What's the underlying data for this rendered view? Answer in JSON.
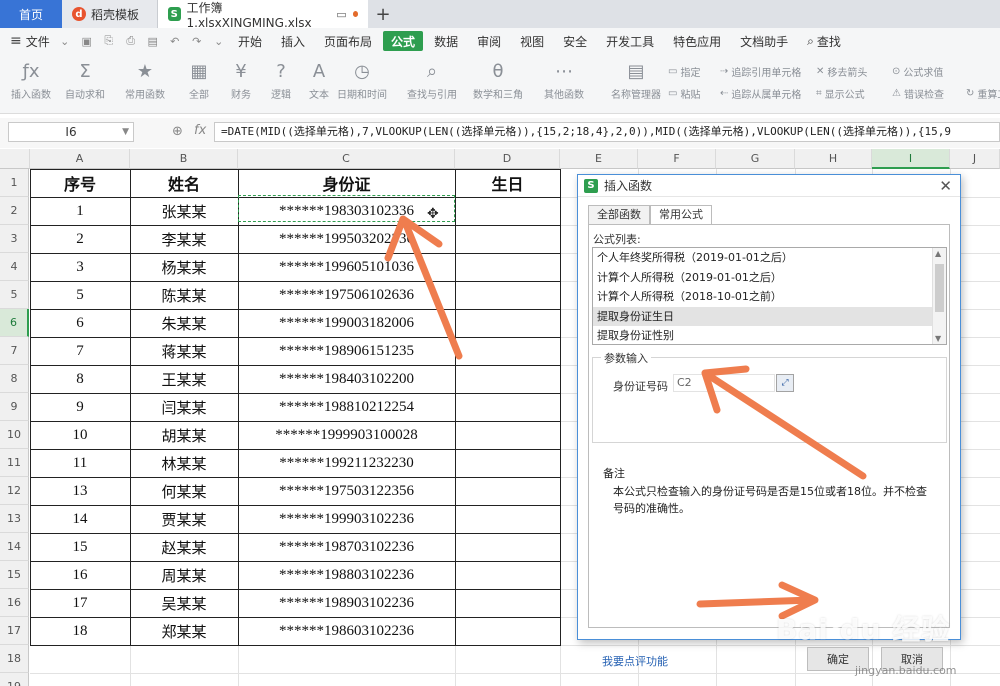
{
  "tabs": {
    "home": "首页",
    "template": "稻壳模板",
    "document": "工作簿1.xlsxXINGMING.xlsx",
    "add": "+"
  },
  "menu": {
    "file": "文件",
    "items": [
      "开始",
      "插入",
      "页面布局",
      "公式",
      "数据",
      "审阅",
      "视图",
      "安全",
      "开发工具",
      "特色应用",
      "文档助手"
    ],
    "active_index": 3,
    "search": "查找"
  },
  "ribbon": {
    "buttons": [
      "插入函数",
      "自动求和",
      "常用函数",
      "全部",
      "财务",
      "逻辑",
      "文本",
      "日期和时间",
      "查找与引用",
      "数学和三角",
      "其他函数",
      "名称管理器"
    ],
    "small": {
      "define": "指定",
      "paste": "粘贴",
      "trace_precedents": "追踪引用单元格",
      "trace_dependents": "追踪从属单元格",
      "remove_arrows": "移去箭头",
      "show_formulas": "显示公式",
      "evaluate": "公式求值",
      "error_check": "错误检查",
      "recalc": "重算工"
    }
  },
  "formula_bar": {
    "name_box": "I6",
    "formula": "=DATE(MID((选择单元格),7,VLOOKUP(LEN((选择单元格)),{15,2;18,4},2,0)),MID((选择单元格),VLOOKUP(LEN((选择单元格)),{15,9"
  },
  "sheet": {
    "columns": [
      "A",
      "B",
      "C",
      "D",
      "E",
      "F",
      "G",
      "H",
      "I",
      "J"
    ],
    "selected_column": "I",
    "selected_row": "6",
    "headers": [
      "序号",
      "姓名",
      "身份证",
      "生日"
    ],
    "rows": [
      {
        "row": "2",
        "no": "1",
        "name": "张某某",
        "id": "******198303102336"
      },
      {
        "row": "3",
        "no": "2",
        "name": "李某某",
        "id": "******199503202336"
      },
      {
        "row": "4",
        "no": "3",
        "name": "杨某某",
        "id": "******199605101036"
      },
      {
        "row": "5",
        "no": "5",
        "name": "陈某某",
        "id": "******197506102636"
      },
      {
        "row": "6",
        "no": "6",
        "name": "朱某某",
        "id": "******199003182006"
      },
      {
        "row": "7",
        "no": "7",
        "name": "蒋某某",
        "id": "******198906151235"
      },
      {
        "row": "8",
        "no": "8",
        "name": "王某某",
        "id": "******198403102200"
      },
      {
        "row": "9",
        "no": "9",
        "name": "闫某某",
        "id": "******198810212254"
      },
      {
        "row": "10",
        "no": "10",
        "name": "胡某某",
        "id": "******1999903100028"
      },
      {
        "row": "11",
        "no": "11",
        "name": "林某某",
        "id": "******199211232230"
      },
      {
        "row": "12",
        "no": "13",
        "name": "何某某",
        "id": "******197503122356"
      },
      {
        "row": "13",
        "no": "14",
        "name": "贾某某",
        "id": "******199903102236"
      },
      {
        "row": "14",
        "no": "15",
        "name": "赵某某",
        "id": "******198703102236"
      },
      {
        "row": "15",
        "no": "16",
        "name": "周某某",
        "id": "******198803102236"
      },
      {
        "row": "16",
        "no": "17",
        "name": "吴某某",
        "id": "******198903102236"
      },
      {
        "row": "17",
        "no": "18",
        "name": "郑某某",
        "id": "******198603102236"
      }
    ],
    "row_header_labels": [
      "1",
      "2",
      "3",
      "4",
      "5",
      "6",
      "7",
      "8",
      "9",
      "10",
      "11",
      "12",
      "13",
      "14",
      "15",
      "16",
      "17",
      "18",
      "19"
    ]
  },
  "dialog": {
    "title": "插入函数",
    "tabs": [
      "全部函数",
      "常用公式"
    ],
    "active_tab": 1,
    "list_label": "公式列表:",
    "list_items": [
      "个人年终奖所得税（2019-01-01之后）",
      "计算个人所得税（2019-01-01之后）",
      "计算个人所得税（2018-10-01之前）",
      "提取身份证生日",
      "提取身份证性别"
    ],
    "selected_index": 3,
    "params_label": "参数输入",
    "param_name": "身份证号码",
    "param_value": "C2",
    "note_title": "备注",
    "note_text": "本公式只检查输入的身份证号码是否是15位或者18位。并不检查号码的准确性。",
    "feedback_link": "我要点评功能",
    "ok": "确定",
    "cancel": "取消"
  },
  "watermark": {
    "brand": "Bai du 经验",
    "url": "jingyan.baidu.com"
  },
  "colors": {
    "accent_green": "#2e9e4f",
    "arrow_orange": "#ef7d4e",
    "home_tab_blue": "#3874d6"
  }
}
